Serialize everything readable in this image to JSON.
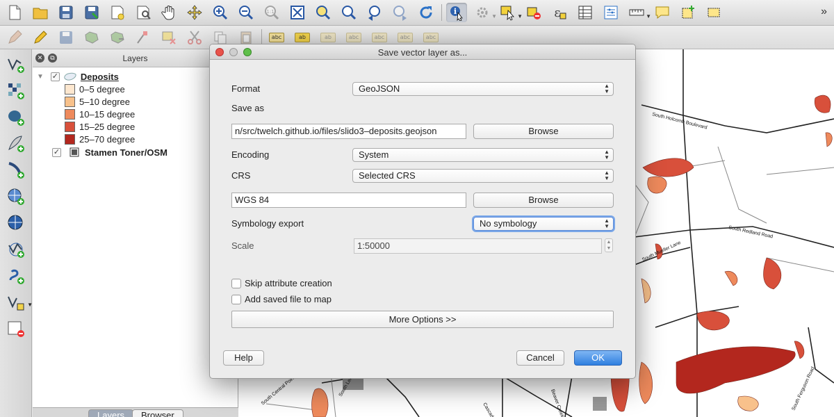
{
  "toolbar_main": {
    "icons": [
      "new-project-icon",
      "open-project-icon",
      "save-project-icon",
      "save-as-icon",
      "new-print-composer-icon",
      "composer-manager-icon",
      "pan-icon",
      "pan-to-selection-icon",
      "zoom-in-icon",
      "zoom-out-icon",
      "zoom-native-icon",
      "zoom-full-icon",
      "zoom-to-selection-icon",
      "zoom-to-layer-icon",
      "zoom-last-icon",
      "zoom-next-icon",
      "refresh-icon",
      "identify-icon",
      "action-icon",
      "select-feature-icon",
      "deselect-icon",
      "field-calculator-icon",
      "attribute-table-icon",
      "statistics-icon",
      "measure-icon",
      "annotation-icon",
      "new-bookmark-icon",
      "show-bookmarks-icon"
    ],
    "overflow": "»"
  },
  "toolbar_digitize": {
    "abc": "abc",
    "ab": "ab"
  },
  "layers_panel": {
    "title": "Layers",
    "group": {
      "name": "Deposits"
    },
    "legend": [
      {
        "label": "0–5 degree",
        "color": "#fde7cf"
      },
      {
        "label": "5–10 degree",
        "color": "#f8c18b"
      },
      {
        "label": "10–15 degree",
        "color": "#ee8a5c"
      },
      {
        "label": "15–25 degree",
        "color": "#d8503b"
      },
      {
        "label": "25–70 degree",
        "color": "#b3271e"
      }
    ],
    "basemap": "Stamen Toner/OSM",
    "tabs": [
      "Layers",
      "Browser"
    ]
  },
  "map": {
    "roads": [
      "South Holcomb Boulevard",
      "South Redland Road",
      "South Mueller Lane",
      "South Central Point Road",
      "South Leland Road",
      "Beaver Creek Road",
      "Cascade",
      "South Ferguson Road"
    ]
  },
  "dialog": {
    "title": "Save vector layer as...",
    "format_label": "Format",
    "format_value": "GeoJSON",
    "save_as_label": "Save as",
    "save_as_value": "n/src/twelch.github.io/files/slido3–deposits.geojson",
    "browse1": "Browse",
    "encoding_label": "Encoding",
    "encoding_value": "System",
    "crs_label": "CRS",
    "crs_value": "Selected CRS",
    "crs_name": "WGS 84",
    "browse2": "Browse",
    "symbology_label": "Symbology export",
    "symbology_value": "No symbology",
    "scale_label": "Scale",
    "scale_value": "1:50000",
    "skip_attr_label": "Skip attribute creation",
    "add_map_label": "Add saved file to map",
    "more_options": "More Options >>",
    "help": "Help",
    "cancel": "Cancel",
    "ok": "OK"
  }
}
